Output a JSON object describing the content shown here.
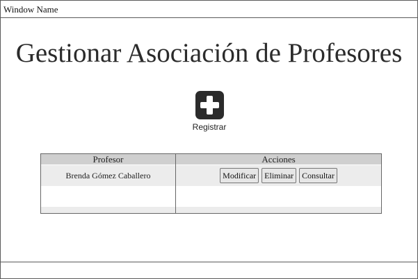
{
  "window": {
    "title": "Window Name"
  },
  "page": {
    "title": "Gestionar Asociación de Profesores"
  },
  "register": {
    "label": "Registrar",
    "icon": "plus-icon"
  },
  "table": {
    "headers": [
      "Profesor",
      "Acciones"
    ],
    "rows": [
      {
        "profesor": "Brenda Gómez Caballero",
        "actions": [
          "Modificar",
          "Eliminar",
          "Consultar"
        ]
      }
    ]
  }
}
